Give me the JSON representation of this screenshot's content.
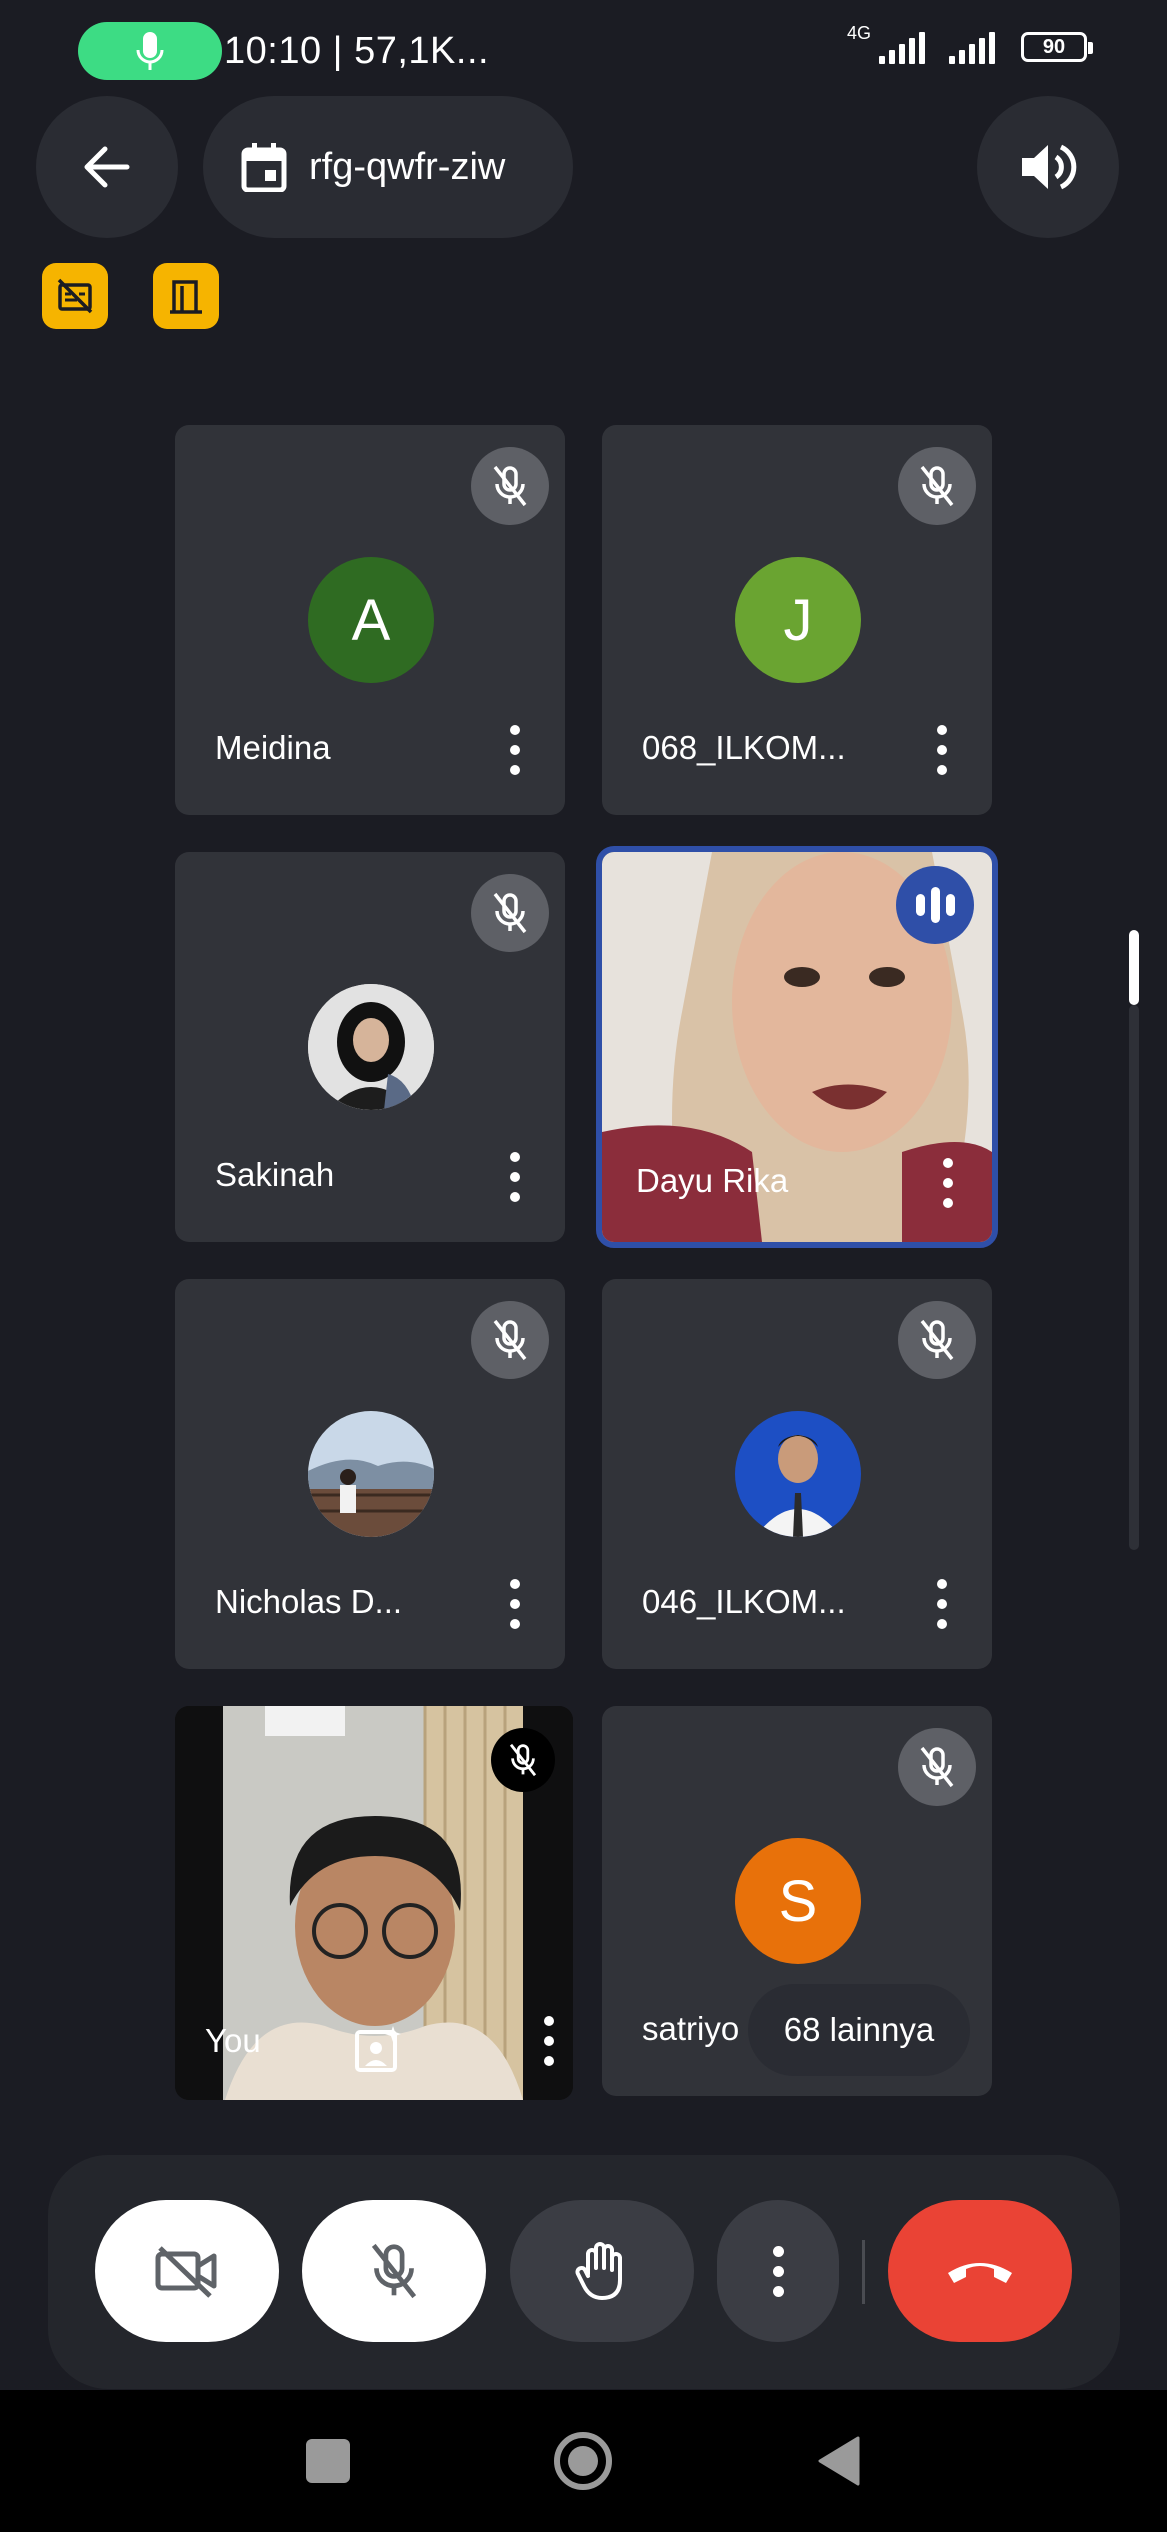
{
  "status_bar": {
    "time_info": "10:10 | 57,1K...",
    "network": "4G",
    "battery": "90",
    "icons": [
      "mic-indicator-icon",
      "signal-icon",
      "battery-icon"
    ]
  },
  "header": {
    "meeting_code": "rfg-qwfr-ziw",
    "icons": [
      "back-arrow-icon",
      "calendar-icon",
      "speaker-icon",
      "no-recording-icon",
      "door-icon"
    ]
  },
  "participants": [
    {
      "name": "Meidina",
      "initial": "A",
      "avatar_color": "#2f6b22",
      "muted": true
    },
    {
      "name": "068_ILKOM...",
      "initial": "J",
      "avatar_color": "#6aa431",
      "muted": true
    },
    {
      "name": "Sakinah",
      "initial": "",
      "avatar_color": "#d7d7d7",
      "muted": true
    },
    {
      "name": "Dayu Rika",
      "initial": "",
      "speaking": true
    },
    {
      "name": "Nicholas D...",
      "initial": "",
      "avatar_color": "#8aa0b6",
      "muted": true
    },
    {
      "name": "046_ILKOM...",
      "initial": "",
      "avatar_color": "#1d4fc4",
      "muted": true
    },
    {
      "name": "You",
      "initial": "",
      "muted": true
    },
    {
      "name": "satriyo",
      "initial": "S",
      "avatar_color": "#e8710a",
      "muted": true
    }
  ],
  "more_participants": "68 lainnya",
  "controls": [
    "camera-off-button",
    "mic-off-button",
    "raise-hand-button",
    "more-options-button",
    "end-call-button"
  ],
  "colors": {
    "background": "#1b1c23",
    "tile": "#313339",
    "accent_green": "#3ddc84",
    "end_call": "#ea4335",
    "speaking_border": "#2f4fa8"
  }
}
